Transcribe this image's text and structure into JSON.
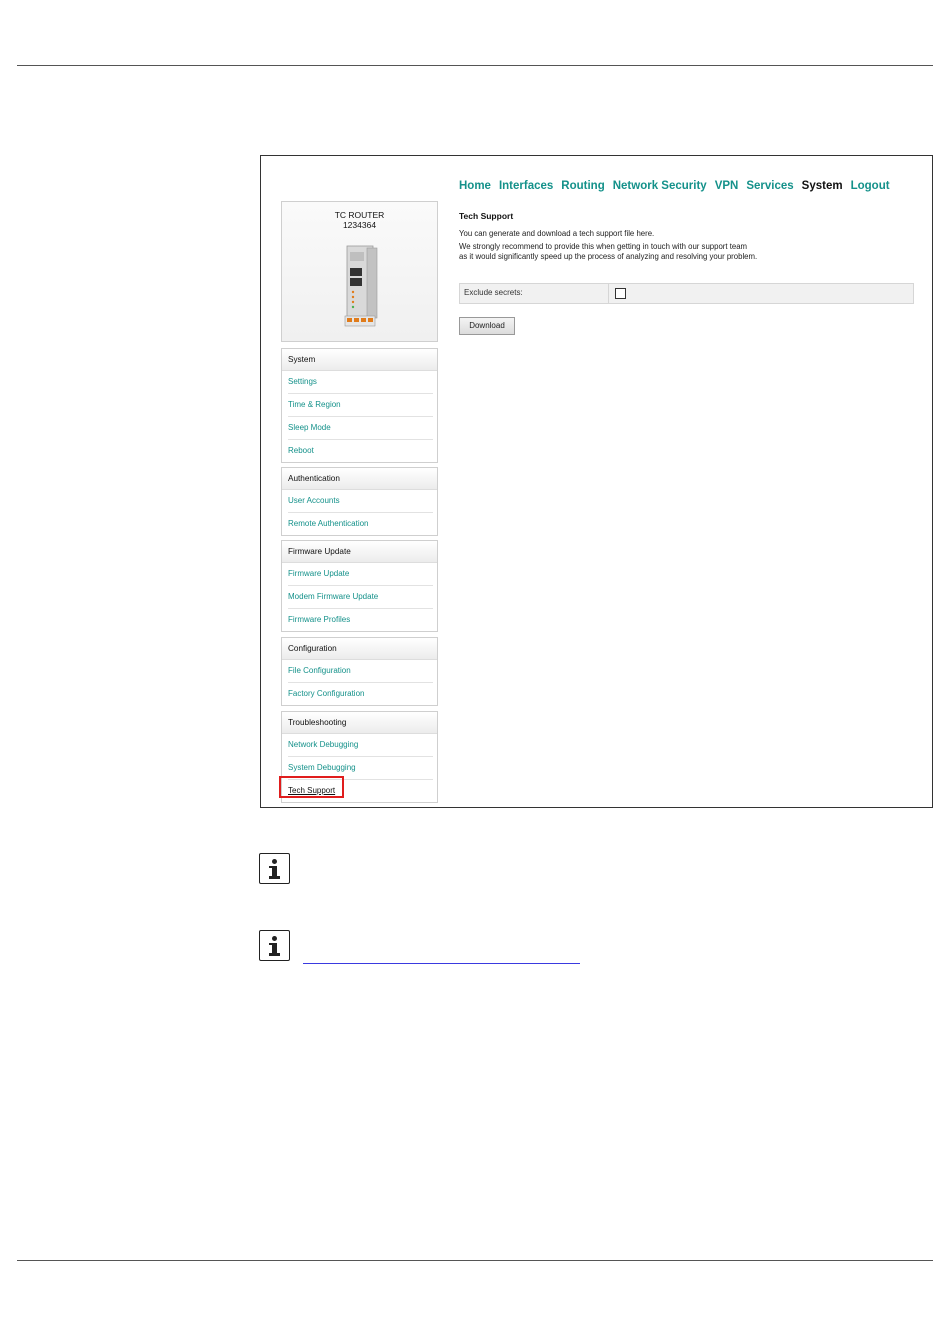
{
  "nav": {
    "items": [
      "Home",
      "Interfaces",
      "Routing",
      "Network Security",
      "VPN",
      "Services",
      "System",
      "Logout"
    ],
    "active": "System"
  },
  "device": {
    "name": "TC ROUTER",
    "serial": "1234364"
  },
  "sidebar": {
    "system": {
      "title": "System",
      "items": [
        "Settings",
        "Time & Region",
        "Sleep Mode",
        "Reboot"
      ]
    },
    "authentication": {
      "title": "Authentication",
      "items": [
        "User Accounts",
        "Remote Authentication"
      ]
    },
    "firmware": {
      "title": "Firmware Update",
      "items": [
        "Firmware Update",
        "Modem Firmware Update",
        "Firmware Profiles"
      ]
    },
    "configuration": {
      "title": "Configuration",
      "items": [
        "File Configuration",
        "Factory Configuration"
      ]
    },
    "troubleshooting": {
      "title": "Troubleshooting",
      "items": [
        "Network Debugging",
        "System Debugging",
        "Tech Support"
      ]
    }
  },
  "content": {
    "title": "Tech Support",
    "intro": "You can generate and download a tech support file here.",
    "recommend_line1": "We strongly recommend to provide this when getting in touch with our support team",
    "recommend_line2": "as it would significantly speed up the process of analyzing and resolving your problem.",
    "exclude_label": "Exclude secrets:",
    "exclude_checked": false,
    "download_label": "Download"
  },
  "colors": {
    "link": "#14918a",
    "highlight": "#e01d1d"
  }
}
